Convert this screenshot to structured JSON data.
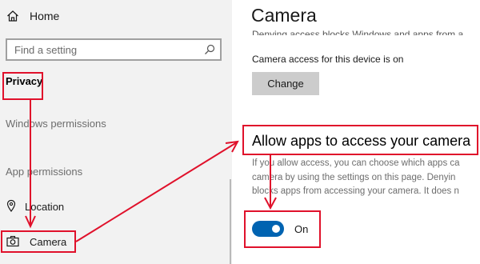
{
  "sidebar": {
    "home_label": "Home",
    "search_placeholder": "Find a setting",
    "privacy_label": "Privacy",
    "windows_permissions_label": "Windows permissions",
    "app_permissions_label": "App permissions",
    "location_label": "Location",
    "camera_label": "Camera"
  },
  "main": {
    "title": "Camera",
    "cut_off_text": "Denying access blocks Windows and apps from a",
    "access_status": "Camera access for this device is on",
    "change_button_label": "Change",
    "section_heading": "Allow apps to access your camera",
    "description_lines": [
      "If you allow access, you can choose which apps ca",
      "camera by using the settings on this page. Denyin",
      "blocks apps from accessing your camera. It does n"
    ],
    "toggle_label": "On",
    "toggle_on": true
  },
  "colors": {
    "annotation_red": "#e0112b",
    "toggle_blue": "#0063b1",
    "sidebar_bg": "#f2f2f2"
  },
  "icons": {
    "home": "home-icon",
    "search": "search-icon",
    "location": "location-icon",
    "camera": "camera-icon"
  }
}
